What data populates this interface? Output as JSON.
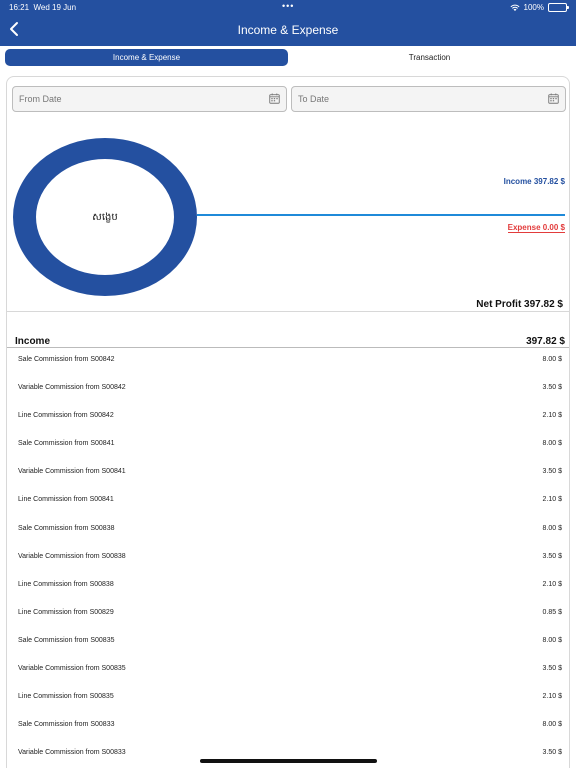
{
  "status_bar": {
    "time": "16:21",
    "date": "Wed 19 Jun",
    "dots": "•••",
    "battery": "100%"
  },
  "header": {
    "title": "Income & Expense",
    "back_icon": "chevron-left-icon"
  },
  "tabs": [
    {
      "label": "Income & Expense",
      "active": true
    },
    {
      "label": "Transaction",
      "active": false
    }
  ],
  "filters": {
    "from_placeholder": "From Date",
    "to_placeholder": "To Date",
    "icon": "calendar-icon"
  },
  "chart_data": {
    "type": "pie",
    "center_label": "សង្ខេប",
    "categories": [
      "Income",
      "Expense"
    ],
    "values": [
      397.82,
      0.0
    ],
    "colors": {
      "Income": "#2450a0",
      "Expense": "#e23b3b"
    }
  },
  "legend": {
    "income": "Income 397.82 $",
    "expense": "Expense 0.00 $"
  },
  "net_profit": "Net Profit 397.82 $",
  "income_section": {
    "label": "Income",
    "total": "397.82 $",
    "items": [
      {
        "label": "Sale Commission from S00842",
        "value": "8.00 $"
      },
      {
        "label": "Variable Commission from S00842",
        "value": "3.50 $"
      },
      {
        "label": "Line Commission from S00842",
        "value": "2.10 $"
      },
      {
        "label": "Sale Commission from S00841",
        "value": "8.00 $"
      },
      {
        "label": "Variable Commission from S00841",
        "value": "3.50 $"
      },
      {
        "label": "Line Commission from S00841",
        "value": "2.10 $"
      },
      {
        "label": "Sale Commission from S00838",
        "value": "8.00 $"
      },
      {
        "label": "Variable Commission from S00838",
        "value": "3.50 $"
      },
      {
        "label": "Line Commission from S00838",
        "value": "2.10 $"
      },
      {
        "label": "Line Commission from S00829",
        "value": "0.85 $"
      },
      {
        "label": "Sale Commission from S00835",
        "value": "8.00 $"
      },
      {
        "label": "Variable Commission from S00835",
        "value": "3.50 $"
      },
      {
        "label": "Line Commission from S00835",
        "value": "2.10 $"
      },
      {
        "label": "Sale Commission from S00833",
        "value": "8.00 $"
      },
      {
        "label": "Variable Commission from S00833",
        "value": "3.50 $"
      }
    ]
  }
}
